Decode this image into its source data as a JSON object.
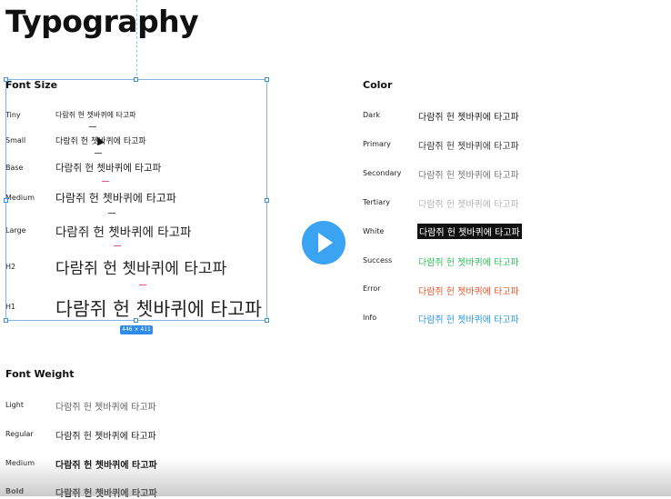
{
  "page_title": "Typography",
  "font_size": {
    "heading": "Font Size",
    "rows": [
      {
        "label": "Tiny",
        "sample": "다람쥐 헌 쳇바퀴에 타고파"
      },
      {
        "label": "Small",
        "sample": "다람쥐 헌 쳇바퀴에 타고파"
      },
      {
        "label": "Base",
        "sample": "다람쥐 헌 쳇바퀴에 타고파"
      },
      {
        "label": "Medium",
        "sample": "다람쥐 헌 쳇바퀴에 타고파"
      },
      {
        "label": "Large",
        "sample": "다람쥐 헌 쳇바퀴에 타고파"
      },
      {
        "label": "H2",
        "sample": "다람쥐 헌 쳇바퀴에 타고파"
      },
      {
        "label": "H1",
        "sample": "다람쥐 헌 쳇바퀴에 타고파"
      }
    ]
  },
  "selection": {
    "dimensions": "446 × 411"
  },
  "color": {
    "heading": "Color",
    "rows": [
      {
        "label": "Dark",
        "sample": "다람쥐 헌 쳇바퀴에 타고파",
        "color": "#222222"
      },
      {
        "label": "Primary",
        "sample": "다람쥐 헌 쳇바퀴에 타고파",
        "color": "#3a3a3a"
      },
      {
        "label": "Secondary",
        "sample": "다람쥐 헌 쳇바퀴에 타고파",
        "color": "#7a7a7a"
      },
      {
        "label": "Tertiary",
        "sample": "다람쥐 헌 쳇바퀴에 타고파",
        "color": "#b5b5b5"
      },
      {
        "label": "White",
        "sample": "다람쥐 헌 쳇바퀴에 타고파",
        "color": "#ffffff"
      },
      {
        "label": "Success",
        "sample": "다람쥐 헌 쳇바퀴에 타고파",
        "color": "#2fbf5b"
      },
      {
        "label": "Error",
        "sample": "다람쥐 헌 쳇바퀴에 타고파",
        "color": "#e8572a"
      },
      {
        "label": "Info",
        "sample": "다람쥐 헌 쳇바퀴에 타고파",
        "color": "#2d9ae0"
      }
    ]
  },
  "font_weight": {
    "heading": "Font Weight",
    "rows": [
      {
        "label": "Light",
        "sample": "다람쥐 헌 쳇바퀴에 타고파"
      },
      {
        "label": "Regular",
        "sample": "다람쥐 헌 쳇바퀴에 타고파"
      },
      {
        "label": "Medium",
        "sample": "다람쥐 헌 쳇바퀴에 타고파"
      },
      {
        "label": "Bold",
        "sample": "다람쥐 헌 쳇바퀴에 타고파"
      }
    ]
  },
  "icons": {
    "play": "play-icon",
    "cursor": "cursor-icon"
  },
  "colors": {
    "selection": "#3d8fe0",
    "play_button": "#3aa3f2",
    "spacing_marker": "#e0529c"
  }
}
